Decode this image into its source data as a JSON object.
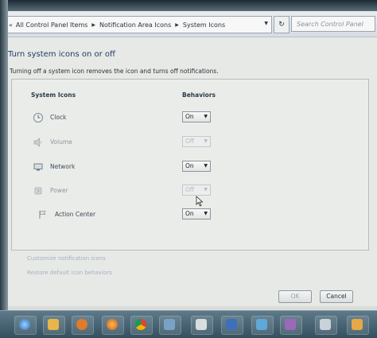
{
  "address_bar": {
    "breadcrumbs": [
      "All Control Panel Items",
      "Notification Area Icons",
      "System Icons"
    ],
    "search_placeholder": "Search Control Panel"
  },
  "page": {
    "title": "Turn system icons on or off",
    "description": "Turning off a system icon removes the icon and turns off notifications."
  },
  "table": {
    "col_icons": "System Icons",
    "col_behaviors": "Behaviors",
    "rows": [
      {
        "name": "Clock",
        "icon": "clock-icon",
        "value": "On",
        "enabled": true
      },
      {
        "name": "Volume",
        "icon": "speaker-icon",
        "value": "Off",
        "enabled": false
      },
      {
        "name": "Network",
        "icon": "network-icon",
        "value": "On",
        "enabled": true
      },
      {
        "name": "Power",
        "icon": "power-icon",
        "value": "Off",
        "enabled": false
      },
      {
        "name": "Action Center",
        "icon": "flag-icon",
        "value": "On",
        "enabled": true
      }
    ]
  },
  "links": {
    "customize": "Customize notification icons",
    "restore": "Restore default icon behaviors"
  },
  "buttons": {
    "ok": "OK",
    "cancel": "Cancel"
  },
  "colors": {
    "title": "#1f3d67",
    "link": "#a4b2c2"
  }
}
